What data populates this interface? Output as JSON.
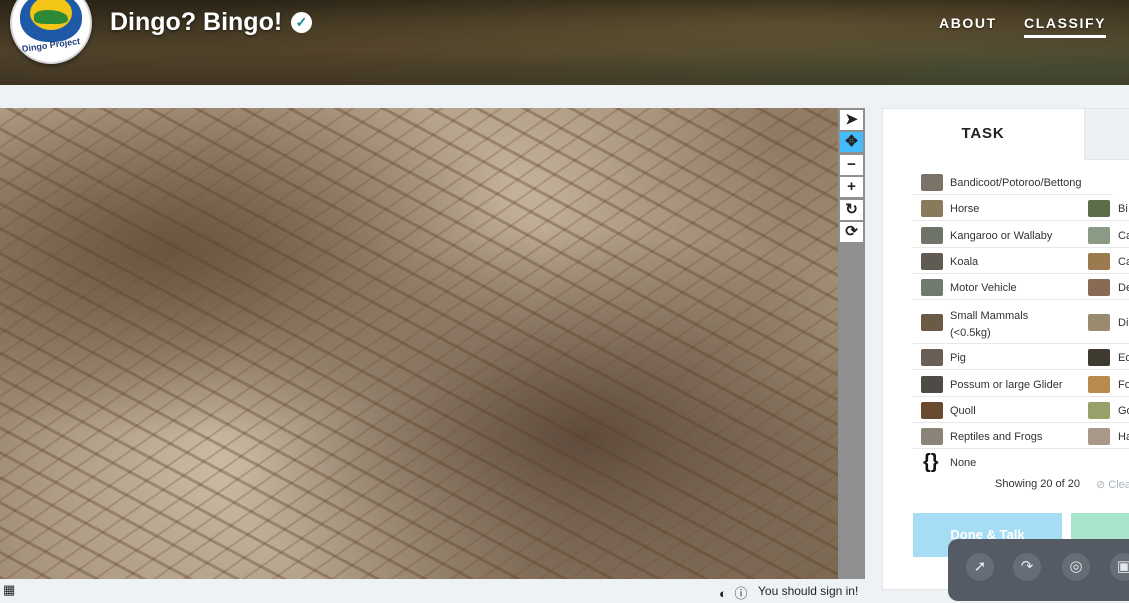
{
  "header": {
    "logo_text": "Dingo Project",
    "title": "Dingo? Bingo!",
    "verified_icon": "check-circle-icon",
    "nav": [
      {
        "label": "ABOUT"
      },
      {
        "label": "CLASSIFY",
        "active": true
      }
    ]
  },
  "toolbar": {
    "tools": [
      {
        "name": "pointer-icon",
        "glyph": "➤",
        "active": false
      },
      {
        "name": "move-icon",
        "glyph": "✥",
        "active": true
      },
      {
        "name": "zoom-out-icon",
        "glyph": "−",
        "active": false
      },
      {
        "name": "zoom-in-icon",
        "glyph": "+",
        "active": false
      },
      {
        "name": "rotate-icon",
        "glyph": "↻",
        "active": false
      },
      {
        "name": "reset-icon",
        "glyph": "⟳",
        "active": false
      }
    ]
  },
  "footer": {
    "signin_text": "You should sign in!"
  },
  "task": {
    "tab_label": "TASK",
    "choices_left": [
      {
        "label": "Bandicoot/Potoroo/Bettong",
        "color": "#7a7468"
      },
      {
        "label": "Horse",
        "color": "#8a7a5c"
      },
      {
        "label": "Kangaroo or Wallaby",
        "color": "#6e7468"
      },
      {
        "label": "Koala",
        "color": "#5f5a52"
      },
      {
        "label": "Motor Vehicle",
        "color": "#707a6e"
      },
      {
        "label": "Small Mammals (<0.5kg)",
        "color": "#6b5a45"
      },
      {
        "label": "Pig",
        "color": "#6a5e55"
      },
      {
        "label": "Possum or large Glider",
        "color": "#4e4a46"
      },
      {
        "label": "Quoll",
        "color": "#6a4a2e"
      },
      {
        "label": "Reptiles and Frogs",
        "color": "#8a8478"
      }
    ],
    "choices_right": [
      {
        "label": "Bi",
        "color": "#5a6e4a"
      },
      {
        "label": "Ca",
        "color": "#8a9a84"
      },
      {
        "label": "Ca",
        "color": "#9a7a4e"
      },
      {
        "label": "De",
        "color": "#8a6a55"
      },
      {
        "label": "Di",
        "color": "#9a8a70"
      },
      {
        "label": "Ec",
        "color": "#3e3a30"
      },
      {
        "label": "Fo",
        "color": "#b88a4e"
      },
      {
        "label": "Go",
        "color": "#9aa06a"
      },
      {
        "label": "Ha",
        "color": "#a8988a"
      }
    ],
    "none_label": "None",
    "showing_text": "Showing 20 of 20",
    "clear_text": "Clea",
    "done_talk_label": "Done & Talk"
  },
  "floating_toolbar": {
    "buttons": [
      "cursor-circle-icon",
      "redo-circle-icon",
      "wifi-cursor-icon",
      "camera-icon"
    ]
  }
}
